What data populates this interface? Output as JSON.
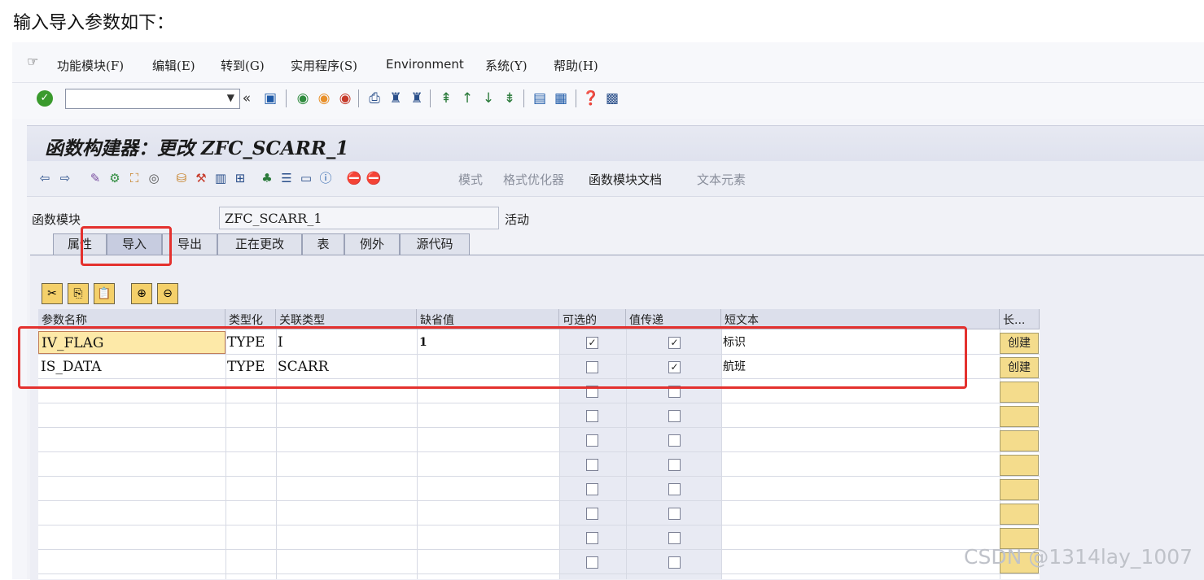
{
  "caption": "输入导入参数如下：",
  "menu": [
    "功能模块(F)",
    "编辑(E)",
    "转到(G)",
    "实用程序(S)",
    "Environment",
    "系统(Y)",
    "帮助(H)"
  ],
  "window_title": "函数构建器：更改 ZFC_SCARR_1",
  "app_toolbar": {
    "mode": "模式",
    "pretty_printer": "格式优化器",
    "fm_doc": "函数模块文档",
    "text_elements": "文本元素"
  },
  "function_module": {
    "label": "函数模块",
    "value": "ZFC_SCARR_1",
    "status": "活动"
  },
  "tabs": [
    "属性",
    "导入",
    "导出",
    "正在更改",
    "表",
    "例外",
    "源代码"
  ],
  "active_tab": "导入",
  "columns": [
    "参数名称",
    "类型化",
    "关联类型",
    "缺省值",
    "可选的",
    "值传递",
    "短文本",
    "长..."
  ],
  "rows": [
    {
      "name": "IV_FLAG",
      "typing": "TYPE",
      "assoc_type": "I",
      "default": "1",
      "optional": true,
      "pass_by_value": true,
      "short_text": "标识",
      "long_text": "创建"
    },
    {
      "name": "IS_DATA",
      "typing": "TYPE",
      "assoc_type": "SCARR",
      "default": "",
      "optional": false,
      "pass_by_value": true,
      "short_text": "航班",
      "long_text": "创建"
    }
  ],
  "empty_rows": 8,
  "watermark": "CSDN @1314lay_1007",
  "colors": {
    "highlight": "#e4312e",
    "tab_active": "#c7cce0",
    "long_button": "#f4dc8c"
  }
}
